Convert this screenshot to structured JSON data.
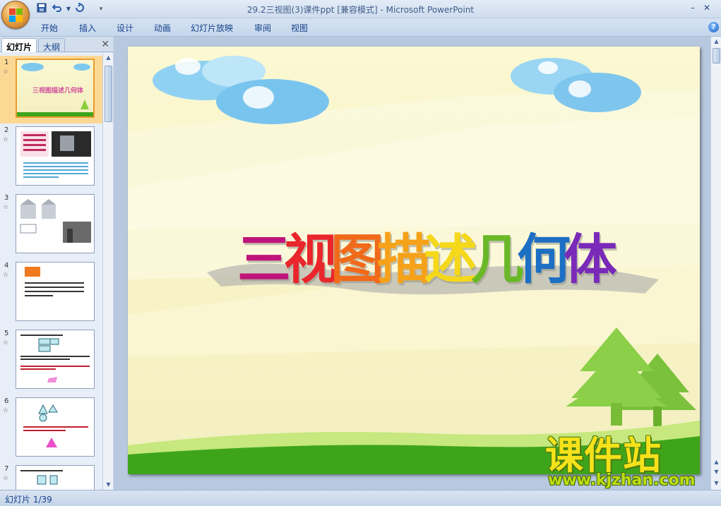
{
  "window": {
    "title": "29.2三视图(3)课件ppt [兼容模式] - Microsoft PowerPoint",
    "minimize": "–",
    "close": "✕"
  },
  "quick_access": {
    "icons": [
      "save-icon",
      "undo-icon",
      "redo-icon",
      "customize-icon"
    ]
  },
  "ribbon": {
    "tabs": [
      "开始",
      "插入",
      "设计",
      "动画",
      "幻灯片放映",
      "审阅",
      "视图"
    ],
    "help": "?"
  },
  "left_pane": {
    "tabs": [
      "幻灯片",
      "大纲"
    ],
    "close": "✕",
    "slides": [
      {
        "num": "1",
        "star": "☆"
      },
      {
        "num": "2",
        "star": "☆"
      },
      {
        "num": "3",
        "star": "☆"
      },
      {
        "num": "4",
        "star": "☆"
      },
      {
        "num": "5",
        "star": "☆"
      },
      {
        "num": "6",
        "star": "☆"
      },
      {
        "num": "7",
        "star": "☆"
      }
    ],
    "active_slide": 1
  },
  "slide": {
    "title_glyphs": [
      {
        "char": "三",
        "color": "#c0147a"
      },
      {
        "char": "视",
        "color": "#e8262b"
      },
      {
        "char": "图",
        "color": "#f06a1a"
      },
      {
        "char": "描",
        "color": "#f5a21a"
      },
      {
        "char": "述",
        "color": "#f5d81a"
      },
      {
        "char": "几",
        "color": "#6ab828"
      },
      {
        "char": "何",
        "color": "#1d6fc4"
      },
      {
        "char": "体",
        "color": "#7a2ab8"
      }
    ]
  },
  "status": {
    "text": "幻灯片 1/39"
  },
  "watermark": {
    "big": "课件站",
    "small": "www.kjzhan.com"
  }
}
